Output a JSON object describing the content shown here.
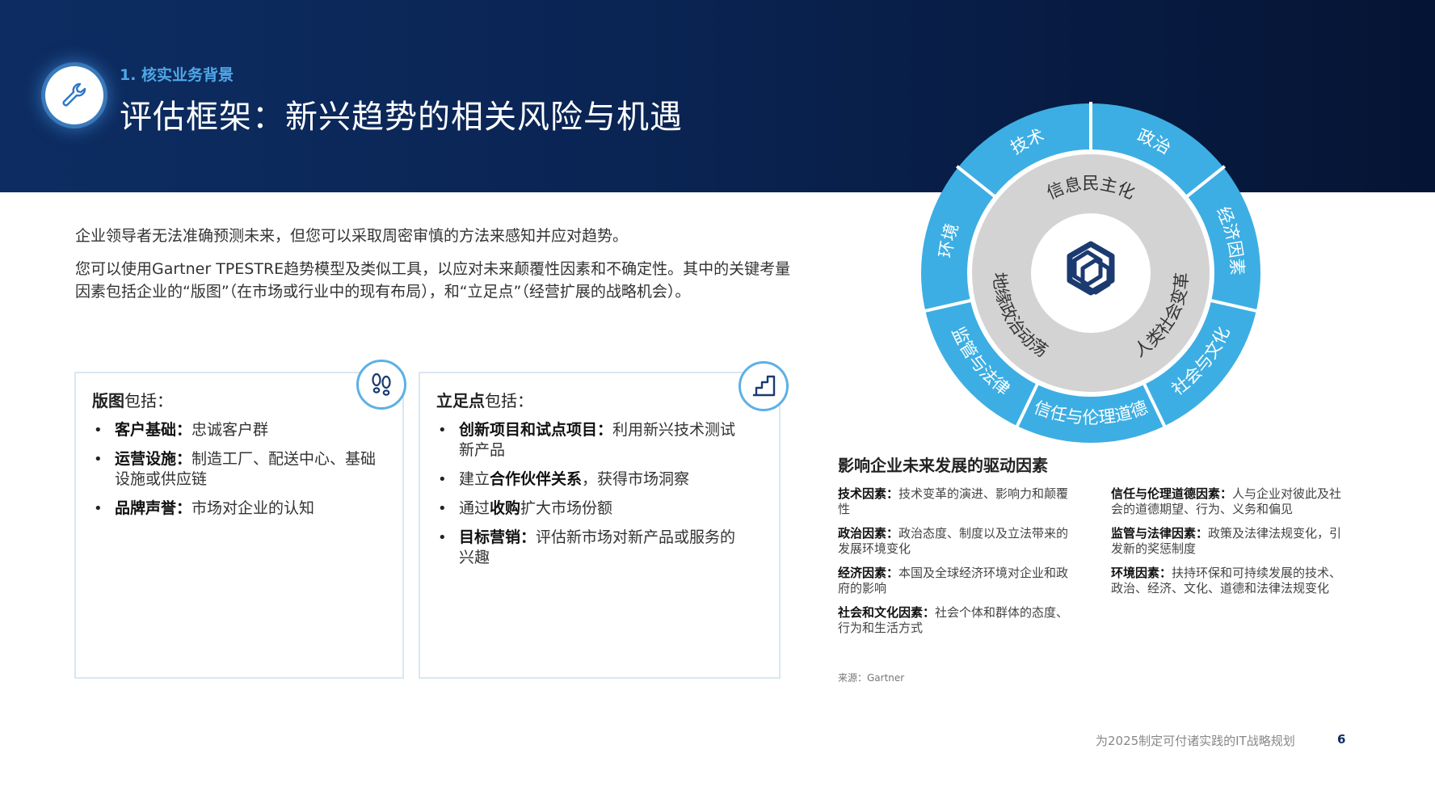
{
  "header": {
    "section_label": "1. 核实业务背景",
    "title": "评估框架：新兴趋势的相关风险与机遇",
    "icon": "wrench-icon"
  },
  "intro": {
    "paragraph1": "企业领导者无法准确预测未来，但您可以采取周密审慎的方法来感知并应对趋势。",
    "paragraph2": "您可以使用Gartner TPESTRE趋势模型及类似工具，以应对未来颠覆性因素和不确定性。其中的关键考量因素包括企业的“版图”（在市场或行业中的现有布局），和“立足点”（经营扩展的战略机会）。"
  },
  "cards": {
    "territory": {
      "title_bold": "版图",
      "title_rest": "包括：",
      "icon": "footprints-icon",
      "items": [
        {
          "bold": "客户基础：",
          "text": "忠诚客户群"
        },
        {
          "bold": "运营设施：",
          "text": "制造工厂、配送中心、基础设施或供应链"
        },
        {
          "bold": "品牌声誉：",
          "text": "市场对企业的认知"
        }
      ]
    },
    "foothold": {
      "title_bold": "立足点",
      "title_rest": "包括：",
      "icon": "stairs-icon",
      "items": [
        {
          "pre": "",
          "bold": "创新项目和试点项目：",
          "text": "利用新兴技术测试新产品"
        },
        {
          "pre": "建立",
          "bold": "合作伙伴关系",
          "text": "，获得市场洞察"
        },
        {
          "pre": "通过",
          "bold": "收购",
          "text": "扩大市场份额"
        },
        {
          "pre": "",
          "bold": "目标营销：",
          "text": "评估新市场对新产品或服务的兴趣"
        }
      ]
    }
  },
  "wheel": {
    "colors": {
      "outer": "#3daee3",
      "inner": "#d3d3d3",
      "center": "#ffffff",
      "logo": "#1b3a70"
    },
    "outer_segments": [
      "技术",
      "政治",
      "经济因素",
      "社会与文化",
      "信任与伦理道德",
      "监管与法律",
      "环境"
    ],
    "inner_labels": [
      "信息民主化",
      "人类社会变革",
      "地缘政治动荡"
    ],
    "center_icon": "gartner-hexagon-logo-icon"
  },
  "drivers": {
    "title": "影响企业未来发展的驱动因素",
    "left": [
      {
        "bold": "技术因素：",
        "text": "技术变革的演进、影响力和颠覆性"
      },
      {
        "bold": "政治因素：",
        "text": "政治态度、制度以及立法带来的发展环境变化"
      },
      {
        "bold": "经济因素：",
        "text": "本国及全球经济环境对企业和政府的影响"
      },
      {
        "bold": "社会和文化因素：",
        "text": "社会个体和群体的态度、行为和生活方式"
      }
    ],
    "right": [
      {
        "bold": "信任与伦理道德因素：",
        "text": "人与企业对彼此及社会的道德期望、行为、义务和偏见"
      },
      {
        "bold": "监管与法律因素：",
        "text": "政策及法律法规变化，引发新的奖惩制度"
      },
      {
        "bold": "环境因素：",
        "text": "扶持环保和可持续发展的技术、政治、经济、文化、道德和法律法规变化"
      }
    ]
  },
  "source": "来源：Gartner",
  "footer": {
    "text": "为2025制定可付诸实践的IT战略规划",
    "page_number": "6"
  }
}
